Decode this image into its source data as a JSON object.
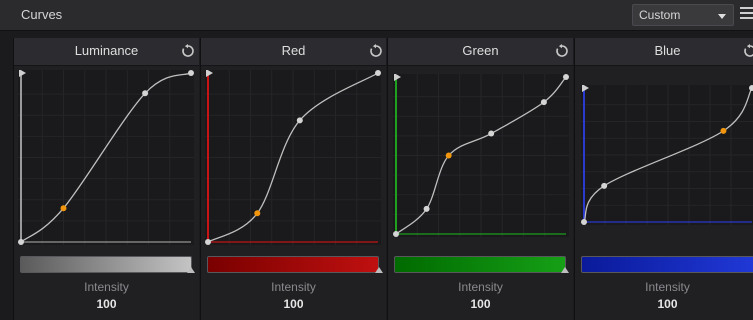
{
  "toolbar": {
    "title": "Curves",
    "preset": {
      "selected": "Custom"
    }
  },
  "panels": [
    {
      "label": "Luminance",
      "color": "#9a9a9a",
      "bar_gradient": [
        "#5a5a5a",
        "#c4c4c4"
      ],
      "intensity_label": "Intensity",
      "intensity_value": "100",
      "points": [
        [
          0,
          0
        ],
        [
          0.25,
          0.2
        ],
        [
          0.73,
          0.88
        ],
        [
          1,
          1
        ]
      ],
      "active_point": 1
    },
    {
      "label": "Red",
      "color": "#c81414",
      "bar_gradient": [
        "#7a0000",
        "#c01010"
      ],
      "intensity_label": "Intensity",
      "intensity_value": "100",
      "points": [
        [
          0,
          0
        ],
        [
          0.29,
          0.17
        ],
        [
          0.54,
          0.72
        ],
        [
          1,
          1
        ]
      ],
      "active_point": 1
    },
    {
      "label": "Green",
      "color": "#1fa11f",
      "bar_gradient": [
        "#006a00",
        "#16a016"
      ],
      "intensity_label": "Intensity",
      "intensity_value": "100",
      "points": [
        [
          0,
          0
        ],
        [
          0.18,
          0.16
        ],
        [
          0.31,
          0.5
        ],
        [
          0.56,
          0.64
        ],
        [
          0.87,
          0.84
        ],
        [
          1,
          1
        ]
      ],
      "active_point": 2
    },
    {
      "label": "Blue",
      "color": "#2a3ad0",
      "bar_gradient": [
        "#0a1a9a",
        "#2038d6"
      ],
      "intensity_label": "Intensity",
      "intensity_value": "100",
      "points": [
        [
          0,
          0
        ],
        [
          0.12,
          0.27
        ],
        [
          0.83,
          0.68
        ],
        [
          1,
          1
        ]
      ],
      "active_point": 2
    }
  ]
}
